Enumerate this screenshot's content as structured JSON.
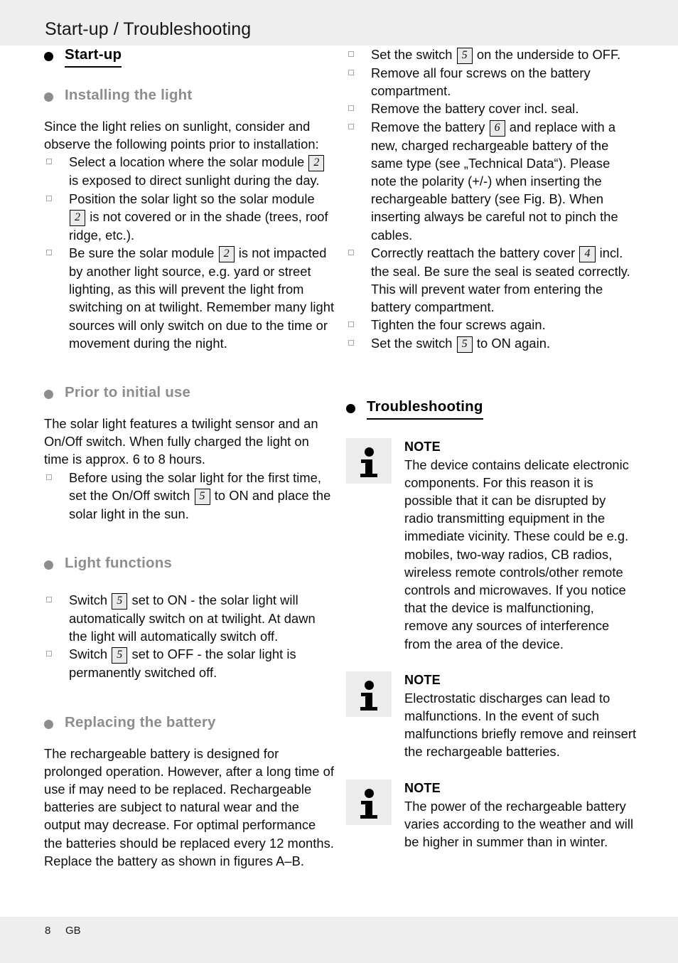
{
  "header": {
    "title": "Start-up / Troubleshooting"
  },
  "footer": {
    "page_number": "8",
    "locale": "GB"
  },
  "colors": {
    "band_gray": "#edeeed",
    "heading_gray": "#8d8d8d",
    "note_icon_bg": "#ebeceb",
    "ref_box_fill": "#e9eae9",
    "text_black": "#0d0d0d"
  },
  "left_column": {
    "heading_start_up": "Start-up",
    "heading_installing": "Installing the light",
    "intro_paragraph": "Since the light relies on sunlight, consider and observe the following points prior to installation:",
    "installing_items": [
      {
        "pre": "Select a location where the solar module",
        "ref": "2",
        "post": "is exposed to direct sunlight during the day."
      },
      {
        "pre": "Position the solar light so the solar module",
        "ref": "2",
        "post": "is not covered or in the shade (trees, roof ridge, etc.)."
      },
      {
        "pre": "Be sure the solar module",
        "ref": "2",
        "post": "is not impacted by another light source, e.g. yard or street lighting, as this will prevent the light from switching on at twilight. Remember many light sources will only switch on due to the time or movement during the night."
      }
    ],
    "heading_prior_use": "Prior to initial use",
    "prior_use_paragraph": "The solar light features a twilight sensor and an On/Off switch. When fully charged the light on time is approx. 6 to 8 hours.",
    "prior_use_items": [
      {
        "pre": "Before using the solar light for the first time, set the On/Off switch",
        "ref": "5",
        "post": "to ON and place the solar light in the sun."
      }
    ],
    "heading_light_functions": "Light functions",
    "light_functions_items": [
      {
        "pre": "Switch",
        "ref": "5",
        "post": "set to ON - the solar light will automatically switch on at twilight. At dawn the light will automatically switch off."
      },
      {
        "pre": "Switch",
        "ref": "5",
        "post": "set to OFF - the solar light is permanently switched off."
      }
    ],
    "heading_replacing_battery": "Replacing the battery",
    "replacing_battery_paragraph": "The rechargeable battery is designed for prolonged operation. However, after a long time of use if may need to be replaced. Rechargeable batteries are subject to natural wear and the output may decrease. For optimal performance the batteries should be replaced every 12 months. Replace the battery as shown in figures A–B."
  },
  "right_column": {
    "battery_steps": [
      {
        "pre": "Set the switch",
        "ref": "5",
        "post": "on the underside to OFF."
      },
      {
        "pre": "Remove all four screws on the battery compartment.",
        "ref": "",
        "post": ""
      },
      {
        "pre": "Remove the battery cover incl. seal.",
        "ref": "",
        "post": ""
      },
      {
        "pre": "Remove the battery",
        "ref": "6",
        "post": "and replace with a new, charged rechargeable battery of the same type (see „Technical Data“). Please note the polarity (+/-) when inserting the rechargeable battery (see Fig. B). When inserting always be careful not to pinch the cables."
      },
      {
        "pre": "Correctly reattach the battery cover",
        "ref": "4",
        "post": "incl. the seal. Be sure the seal is seated correctly. This will prevent water from entering the battery compartment."
      },
      {
        "pre": "Tighten the four screws again.",
        "ref": "",
        "post": ""
      },
      {
        "pre": "Set the switch",
        "ref": "5",
        "post": "to ON again."
      }
    ],
    "heading_troubleshooting": "Troubleshooting",
    "notes": [
      {
        "title": "NOTE",
        "text": "The device contains delicate electronic components. For this reason it is possible that it can be disrupted by radio transmitting equipment in the immediate vicinity. These could be e.g. mobiles, two-way radios, CB radios, wireless remote controls/other remote controls and microwaves. If you notice that the device is malfunctioning, remove any sources of interference from the area of the device."
      },
      {
        "title": "NOTE",
        "text": "Electrostatic discharges can lead to malfunctions. In the event of such malfunctions briefly remove and reinsert the rechargeable batteries."
      },
      {
        "title": "NOTE",
        "text": "The power of the rechargeable battery varies according to the weather and will be higher in summer than in winter."
      }
    ]
  },
  "icons": {
    "note_icon": "info-i-icon",
    "list_bullet": "square-bullet-icon",
    "heading_bullet": "filled-circle-icon"
  }
}
